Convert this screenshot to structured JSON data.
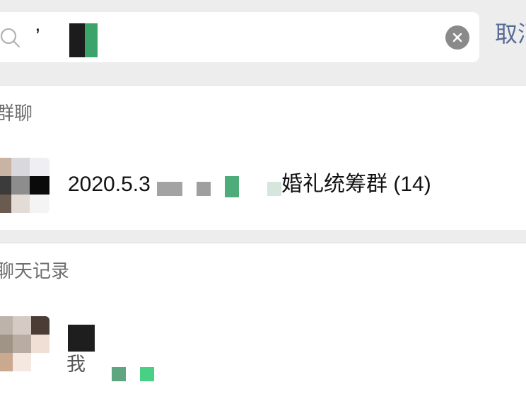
{
  "search": {
    "query": "’",
    "cancel_label": "取消"
  },
  "sections": {
    "groups_header": "群聊",
    "chats_header": "聊天记录"
  },
  "group_result": {
    "name": "2020.5.3",
    "name_suffix": "婚礼统筹群 (14)"
  },
  "chat_result": {
    "snippet_prefix": "我"
  },
  "icons": {
    "search": "search-icon",
    "clear": "clear-icon"
  },
  "colors": {
    "accent": "#576b95",
    "background": "#ededed"
  }
}
